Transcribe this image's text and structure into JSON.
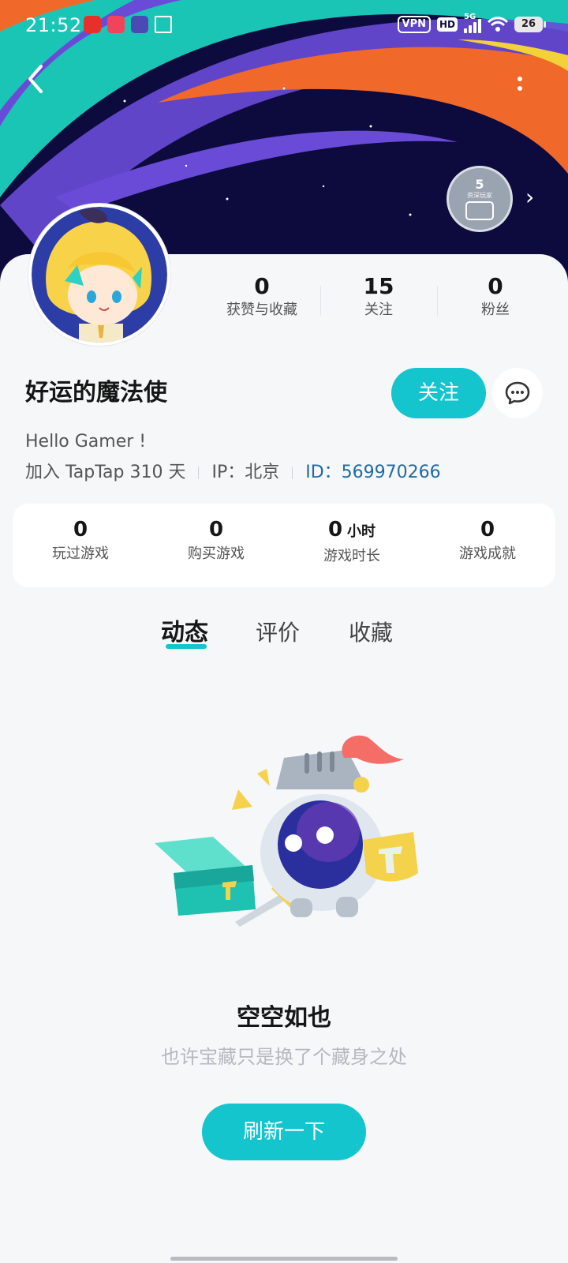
{
  "status_bar": {
    "time": "21:52",
    "vpn": "VPN",
    "hd": "HD",
    "network": "5G",
    "battery": "26"
  },
  "header": {
    "back_icon": "chevron-left-icon",
    "more_icon": "more-vertical-icon",
    "level_badge": {
      "number": "5",
      "caption": "资深玩家"
    }
  },
  "profile": {
    "name": "好运的魔法使",
    "bio": "Hello Gamer !",
    "join": "加入 TapTap 310 天",
    "ip": "IP：北京",
    "id": "ID：569970266",
    "follow_label": "关注"
  },
  "social_stats": [
    {
      "value": "0",
      "label": "获赞与收藏"
    },
    {
      "value": "15",
      "label": "关注"
    },
    {
      "value": "0",
      "label": "粉丝"
    }
  ],
  "game_stats": [
    {
      "value": "0",
      "unit": "",
      "label": "玩过游戏"
    },
    {
      "value": "0",
      "unit": "",
      "label": "购买游戏"
    },
    {
      "value": "0",
      "unit": "小时",
      "label": "游戏时长"
    },
    {
      "value": "0",
      "unit": "",
      "label": "游戏成就"
    }
  ],
  "tabs": [
    {
      "label": "动态",
      "active": true
    },
    {
      "label": "评价",
      "active": false
    },
    {
      "label": "收藏",
      "active": false
    }
  ],
  "empty_state": {
    "title": "空空如也",
    "subtitle": "也许宝藏只是换了个藏身之处",
    "button": "刷新一下"
  },
  "colors": {
    "accent": "#15c5ce",
    "link": "#1f6aa5",
    "header_bg": "#0d0b3d"
  }
}
